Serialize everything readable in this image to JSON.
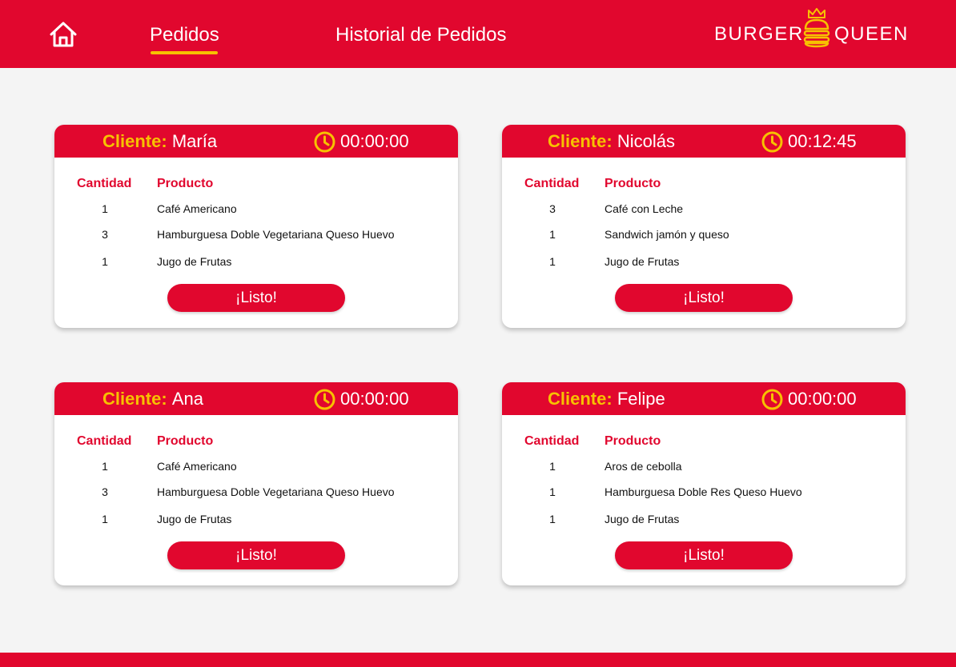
{
  "header": {
    "nav": {
      "home_icon": "home-icon",
      "pedidos": "Pedidos",
      "historial": "Historial de Pedidos"
    },
    "logo": {
      "left": "BURGER",
      "right": "QUEEN",
      "icon": "burger-crown-icon"
    }
  },
  "colors": {
    "primary": "#e1072e",
    "accent": "#f7c100",
    "background": "#f4f4f4",
    "card": "#ffffff"
  },
  "orders": [
    {
      "client_label": "Cliente:",
      "client_name": "María",
      "timer": "00:00:00",
      "qty_header": "Cantidad",
      "product_header": "Producto",
      "items": [
        {
          "qty": "1",
          "product": "Café Americano"
        },
        {
          "qty": "3",
          "product": "Hamburguesa Doble Vegetariana Queso Huevo"
        },
        {
          "qty": "1",
          "product": "Jugo de Frutas"
        }
      ],
      "button": "¡Listo!"
    },
    {
      "client_label": "Cliente:",
      "client_name": "Nicolás",
      "timer": "00:12:45",
      "qty_header": "Cantidad",
      "product_header": "Producto",
      "items": [
        {
          "qty": "3",
          "product": "Café con Leche"
        },
        {
          "qty": "1",
          "product": "Sandwich jamón y queso"
        },
        {
          "qty": "1",
          "product": "Jugo de Frutas"
        }
      ],
      "button": "¡Listo!"
    },
    {
      "client_label": "Cliente:",
      "client_name": "Ana",
      "timer": "00:00:00",
      "qty_header": "Cantidad",
      "product_header": "Producto",
      "items": [
        {
          "qty": "1",
          "product": "Café Americano"
        },
        {
          "qty": "3",
          "product": "Hamburguesa Doble Vegetariana Queso Huevo"
        },
        {
          "qty": "1",
          "product": "Jugo de Frutas"
        }
      ],
      "button": "¡Listo!"
    },
    {
      "client_label": "Cliente:",
      "client_name": "Felipe",
      "timer": "00:00:00",
      "qty_header": "Cantidad",
      "product_header": "Producto",
      "items": [
        {
          "qty": "1",
          "product": "Aros de cebolla"
        },
        {
          "qty": "1",
          "product": "Hamburguesa Doble Res Queso Huevo"
        },
        {
          "qty": "1",
          "product": "Jugo de Frutas"
        }
      ],
      "button": "¡Listo!"
    }
  ]
}
